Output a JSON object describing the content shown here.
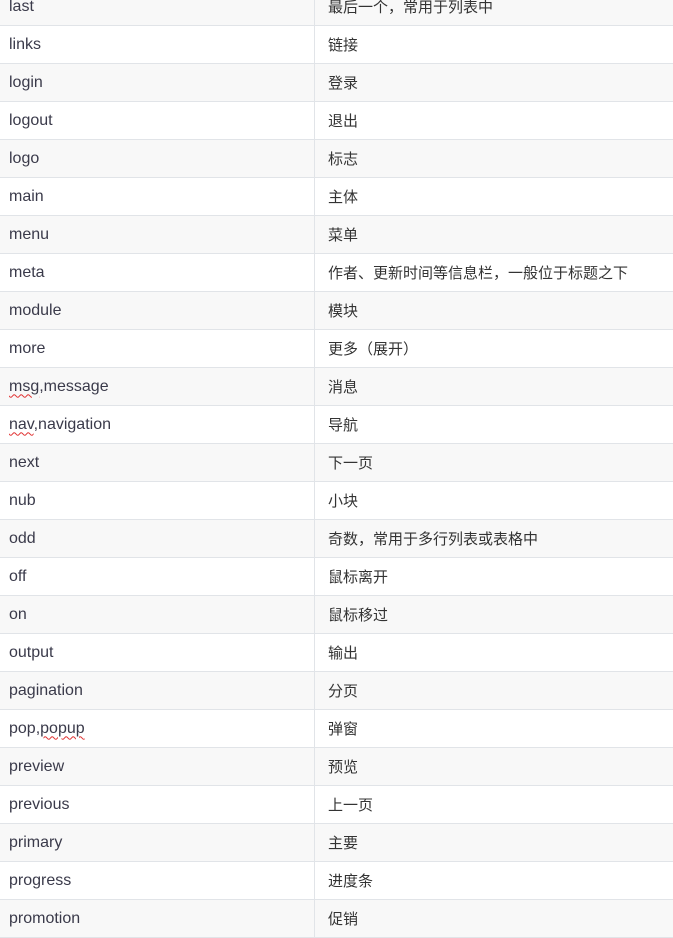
{
  "rows": [
    {
      "name": [
        "last"
      ],
      "desc": "最后一个，常用于列表中"
    },
    {
      "name": [
        "links"
      ],
      "desc": "链接"
    },
    {
      "name": [
        "login"
      ],
      "desc": "登录"
    },
    {
      "name": [
        "logout"
      ],
      "desc": "退出"
    },
    {
      "name": [
        "logo"
      ],
      "desc": "标志"
    },
    {
      "name": [
        "main"
      ],
      "desc": "主体"
    },
    {
      "name": [
        "menu"
      ],
      "desc": "菜单"
    },
    {
      "name": [
        "meta"
      ],
      "desc": "作者、更新时间等信息栏，一般位于标题之下"
    },
    {
      "name": [
        "module"
      ],
      "desc": "模块"
    },
    {
      "name": [
        "more"
      ],
      "desc": "更多（展开）"
    },
    {
      "name": [
        "msg",
        ",message"
      ],
      "spell": [
        0
      ],
      "desc": "消息"
    },
    {
      "name": [
        "nav",
        ",navigation"
      ],
      "spell": [
        0
      ],
      "desc": "导航"
    },
    {
      "name": [
        "next"
      ],
      "desc": "下一页"
    },
    {
      "name": [
        "nub"
      ],
      "desc": "小块"
    },
    {
      "name": [
        "odd"
      ],
      "desc": "奇数，常用于多行列表或表格中"
    },
    {
      "name": [
        "off"
      ],
      "desc": "鼠标离开"
    },
    {
      "name": [
        "on"
      ],
      "desc": "鼠标移过"
    },
    {
      "name": [
        "output"
      ],
      "desc": "输出"
    },
    {
      "name": [
        "pagination"
      ],
      "desc": "分页"
    },
    {
      "name": [
        "pop,",
        "popup"
      ],
      "spell": [
        1
      ],
      "desc": "弹窗"
    },
    {
      "name": [
        "preview"
      ],
      "desc": "预览"
    },
    {
      "name": [
        "previous"
      ],
      "desc": "上一页"
    },
    {
      "name": [
        "primary"
      ],
      "desc": "主要"
    },
    {
      "name": [
        "progress"
      ],
      "desc": "进度条"
    },
    {
      "name": [
        "promotion"
      ],
      "desc": "促销"
    }
  ]
}
